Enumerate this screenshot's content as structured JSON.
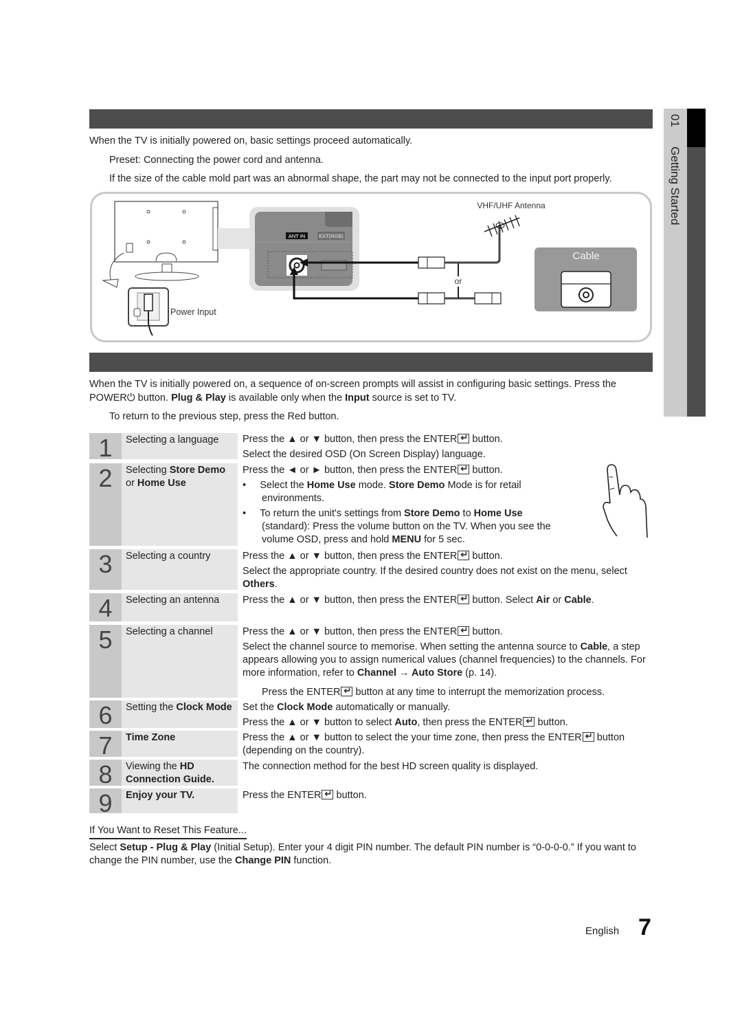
{
  "side_tab": {
    "chapter_number": "01",
    "chapter_title": "Getting Started"
  },
  "section1": {
    "intro": "When the TV is initially powered on, basic settings proceed automatically.",
    "note_preset": "Preset: Connecting the power cord and antenna.",
    "note_cable": "If the size of the cable mold part was an abnormal shape, the part may not be connected to the input port properly."
  },
  "diagram": {
    "power_input_label": "Power Input",
    "ant_in_label": "ANT IN",
    "ext_rgb_label": "EXT(RGB)",
    "antenna_label": "VHF/UHF Antenna",
    "or_label": "or",
    "cable_label": "Cable"
  },
  "section2": {
    "intro_line1": "When the TV is initially powered on, a sequence of on-screen prompts will assist in configuring basic settings. Press the",
    "intro_power": "POWER",
    "intro_after_power": " button. ",
    "intro_plug_play": "Plug & Play",
    "intro_mid": " is available only when the ",
    "intro_input": "Input",
    "intro_end": " source is set to TV.",
    "note_return": "To return to the previous step, press the Red button."
  },
  "steps": [
    {
      "num": "1",
      "title": "Selecting a language",
      "lines": [
        "Press the ▲ or ▼ button, then press the ENTER",
        " button.",
        "Select the desired OSD (On Screen Display) language."
      ]
    },
    {
      "num": "2",
      "title_a": "Selecting ",
      "title_b": "Store Demo",
      "title_c": "or ",
      "title_d": "Home Use",
      "line1a": "Press the ◄ or ► button, then press the ENTER",
      "line1b": " button.",
      "bullet1a": "Select the ",
      "bullet1b": "Home Use",
      "bullet1c": " mode. ",
      "bullet1d": "Store Demo",
      "bullet1e": " Mode is for retail",
      "bullet1f": "environments.",
      "bullet2a": "To return the unit's settings from ",
      "bullet2b": "Store Demo",
      "bullet2c": " to ",
      "bullet2d": "Home Use",
      "bullet2e": "(standard): Press the volume button on the TV. When you see the",
      "bullet2f": "volume OSD, press and hold ",
      "bullet2g": "MENU",
      "bullet2h": " for 5 sec."
    },
    {
      "num": "3",
      "title": "Selecting a country",
      "line1a": "Press the ▲ or ▼ button, then press the ENTER",
      "line1b": " button.",
      "line2": "Select the appropriate country. If the desired country does not exist on the menu, select",
      "line3": "Others",
      "line3b": "."
    },
    {
      "num": "4",
      "title": "Selecting an antenna",
      "line1a": "Press the ▲ or ▼ button, then press the ENTER",
      "line1b": " button. Select ",
      "line1c": "Air",
      "line1d": " or ",
      "line1e": "Cable",
      "line1f": "."
    },
    {
      "num": "5",
      "title": "Selecting a channel",
      "line1a": "Press the ▲ or ▼ button, then press the ENTER",
      "line1b": " button.",
      "line2a": "Select the channel source to memorise. When setting the antenna source to ",
      "line2b": "Cable",
      "line2c": ", a step",
      "line3": "appears allowing you to assign numerical values (channel frequencies) to the channels. For",
      "line4a": "more information, refer to ",
      "line4b": "Channel → Auto Store",
      "line4c": " (p. 14).",
      "note_a": "Press the ENTER",
      "note_b": " button at any time to interrupt the memorization process."
    },
    {
      "num": "6",
      "title_a": "Setting the ",
      "title_b": "Clock Mode",
      "line1a": "Set the ",
      "line1b": "Clock Mode",
      "line1c": " automatically or manually.",
      "line2a": "Press the ▲ or ▼ button to select ",
      "line2b": "Auto",
      "line2c": ", then press the ENTER",
      "line2d": " button."
    },
    {
      "num": "7",
      "title": "Time Zone",
      "line1a": "Press the ▲ or ▼ button to select the your time zone, then press the ENTER",
      "line1b": " button",
      "line2": "(depending on the country)."
    },
    {
      "num": "8",
      "title_a": "Viewing the ",
      "title_b": "HD",
      "title_c": "Connection Guide.",
      "line1": "The connection method for the best HD screen quality is displayed."
    },
    {
      "num": "9",
      "title": "Enjoy your TV.",
      "line1a": "Press the ENTER",
      "line1b": " button."
    }
  ],
  "reset": {
    "title": "If You Want to Reset This Feature...",
    "line1a": "Select ",
    "line1b": "Setup - Plug & Play",
    "line1c": " (Initial Setup). Enter your 4 digit PIN number. The default PIN number is “0-0-0-0.” If you want to",
    "line2a": "change the PIN number, use the ",
    "line2b": "Change PIN",
    "line2c": " function."
  },
  "footer": {
    "language": "English",
    "page_number": "7"
  }
}
